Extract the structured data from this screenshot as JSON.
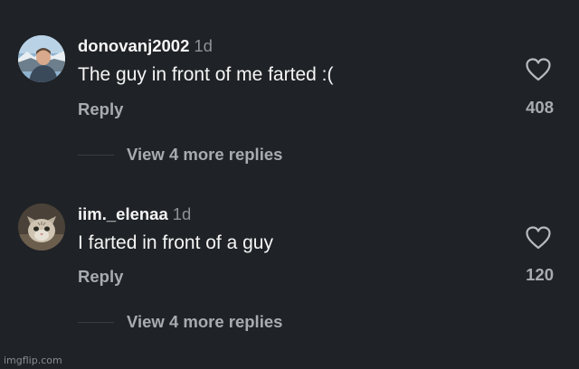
{
  "comments": [
    {
      "username": "donovanj2002",
      "time": "1d",
      "text": "The guy in front of me farted :(",
      "reply_label": "Reply",
      "likes": "408",
      "view_replies": "View 4 more replies",
      "avatar_icon": "person-outdoors-avatar"
    },
    {
      "username": "iim._elenaa",
      "time": "1d",
      "text": "I farted in front of a guy",
      "reply_label": "Reply",
      "likes": "120",
      "view_replies": "View 4 more replies",
      "avatar_icon": "cat-avatar"
    }
  ],
  "like_icon": "heart-outline-icon",
  "colors": {
    "background": "#1f2226",
    "primary_text": "#f5f5f5",
    "secondary_text": "#a8acb0",
    "timestamp": "#8e9296"
  },
  "watermark": "imgflip.com"
}
